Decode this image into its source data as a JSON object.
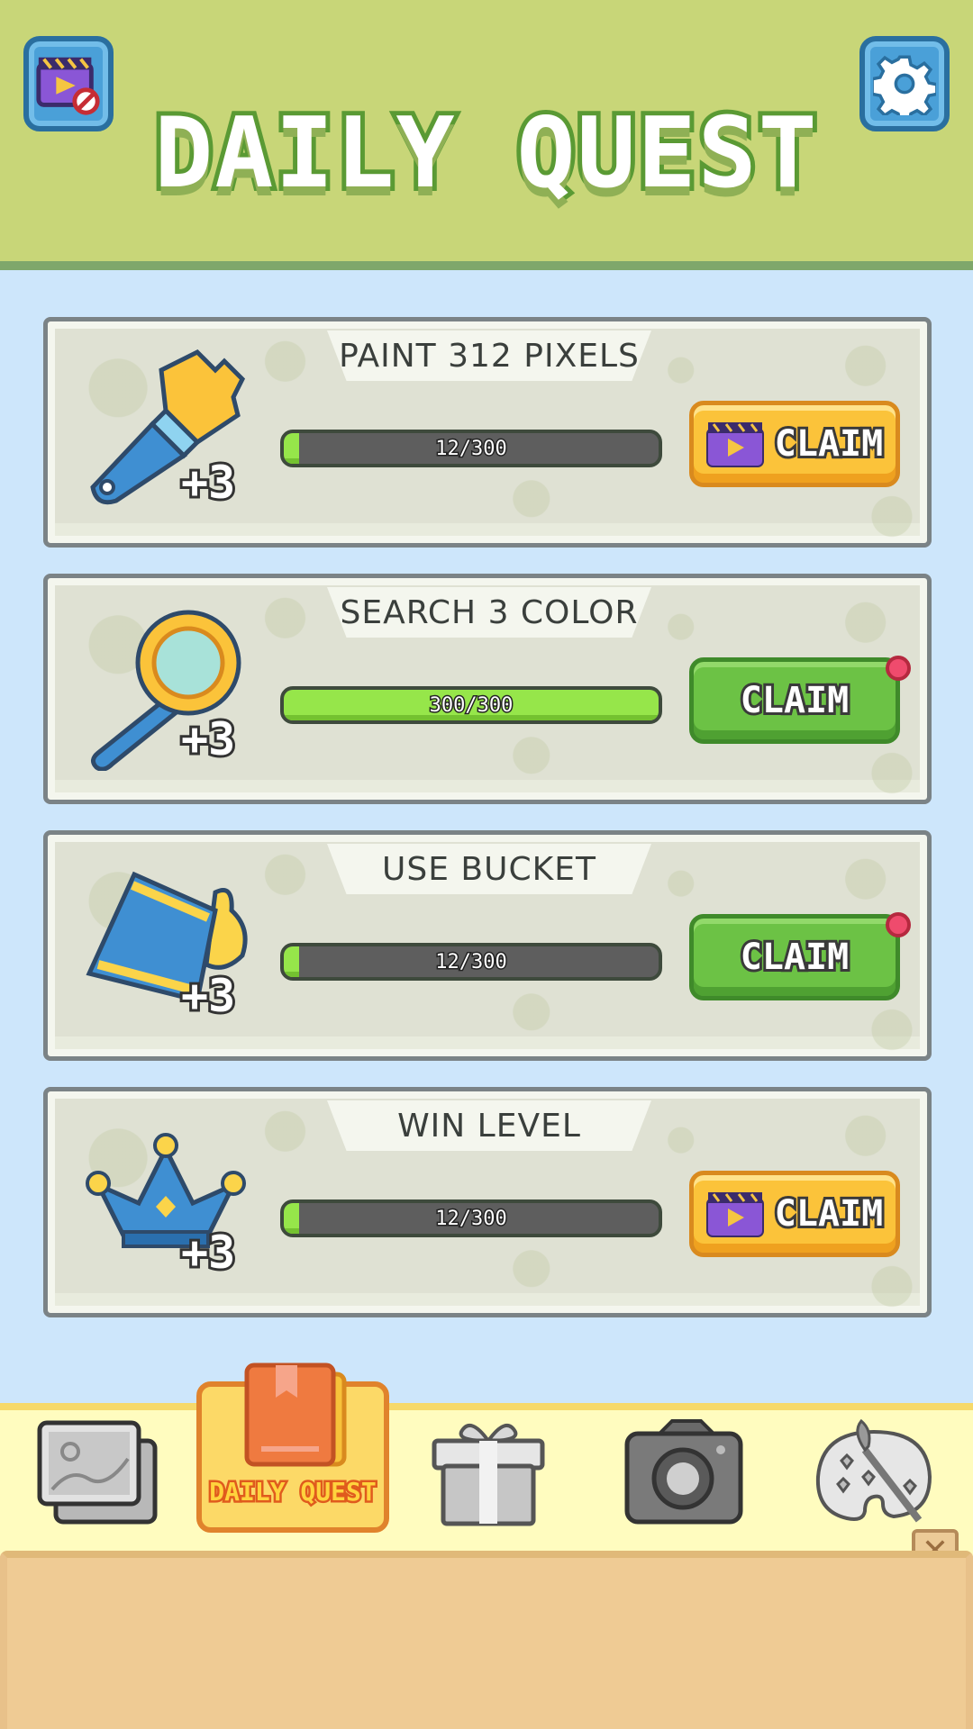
{
  "header": {
    "title": "DAILY QUEST",
    "left_button_icon": "no-ads-video-icon",
    "right_button_icon": "gear-icon"
  },
  "quests": [
    {
      "title": "PAINT 312 PIXELS",
      "icon": "paintbrush-icon",
      "reward": "+3",
      "progress_text": "12/300",
      "progress_fraction": 0.04,
      "claim_label": "CLAIM",
      "claim_style": "video-ad",
      "notification": false
    },
    {
      "title": "SEARCH 3 COLOR",
      "icon": "magnifier-icon",
      "reward": "+3",
      "progress_text": "300/300",
      "progress_fraction": 1.0,
      "claim_label": "CLAIM",
      "claim_style": "ready",
      "notification": true
    },
    {
      "title": "USE BUCKET",
      "icon": "paint-bucket-icon",
      "reward": "+3",
      "progress_text": "12/300",
      "progress_fraction": 0.04,
      "claim_label": "CLAIM",
      "claim_style": "ready",
      "notification": true
    },
    {
      "title": "WIN LEVEL",
      "icon": "crown-icon",
      "reward": "+3",
      "progress_text": "12/300",
      "progress_fraction": 0.04,
      "claim_label": "CLAIM",
      "claim_style": "video-ad",
      "notification": false
    }
  ],
  "nav": {
    "items": [
      {
        "id": "gallery",
        "icon": "gallery-icon"
      },
      {
        "id": "daily-quest",
        "icon": "book-icon",
        "label": "DAILY QUEST",
        "active": true
      },
      {
        "id": "gift",
        "icon": "gift-icon"
      },
      {
        "id": "camera",
        "icon": "camera-icon"
      },
      {
        "id": "palette",
        "icon": "palette-icon"
      }
    ]
  },
  "colors": {
    "header_bg": "#c8d678",
    "page_bg": "#cde6fb",
    "progress_fill": "#96e64a",
    "claim_yellow": "#fbc33a",
    "claim_green": "#6cc245",
    "notification": "#ef4b6d"
  }
}
